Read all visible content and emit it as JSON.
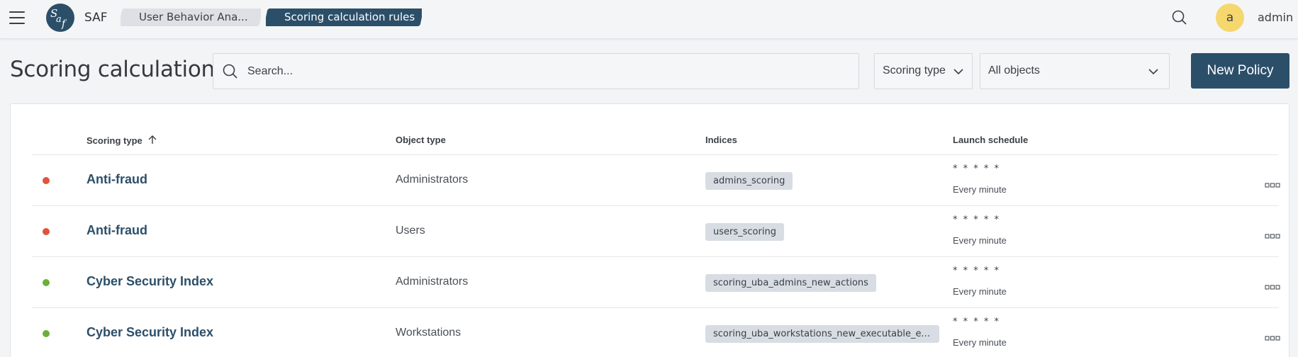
{
  "header": {
    "app_name": "SAF",
    "breadcrumbs": [
      "User Behavior Ana...",
      "Scoring calculation rules"
    ],
    "avatar_letter": "a",
    "username": "admin"
  },
  "toolbar": {
    "title": "Scoring calculations",
    "search_placeholder": "Search...",
    "scoring_type_label": "Scoring type",
    "objects_selected": "All objects",
    "new_policy_label": "New Policy"
  },
  "table": {
    "columns": [
      "Scoring type",
      "Object type",
      "Indices",
      "Launch schedule"
    ],
    "sort": {
      "column": "Scoring type",
      "direction": "ascending"
    },
    "rows": [
      {
        "status_color": "#e0533c",
        "name": "Anti-fraud",
        "object_type": "Administrators",
        "index": "admins_scoring",
        "cron": "* * * * *",
        "schedule": "Every minute"
      },
      {
        "status_color": "#e0533c",
        "name": "Anti-fraud",
        "object_type": "Users",
        "index": "users_scoring",
        "cron": "* * * * *",
        "schedule": "Every minute"
      },
      {
        "status_color": "#6aaf3c",
        "name": "Cyber Security Index",
        "object_type": "Administrators",
        "index": "scoring_uba_admins_new_actions",
        "cron": "* * * * *",
        "schedule": "Every minute"
      },
      {
        "status_color": "#6aaf3c",
        "name": "Cyber Security Index",
        "object_type": "Workstations",
        "index": "scoring_uba_workstations_new_executable_exten...",
        "cron": "* * * * *",
        "schedule": "Every minute"
      }
    ]
  },
  "colors": {
    "brand": "#2c4f69",
    "avatar": "#f5d76e",
    "status_red": "#e0533c",
    "status_green": "#6aaf3c"
  },
  "icons": [
    "menu-icon",
    "logo-icon",
    "search-icon",
    "chevron-down-icon",
    "sort-arrow-up-icon",
    "more-icon"
  ]
}
